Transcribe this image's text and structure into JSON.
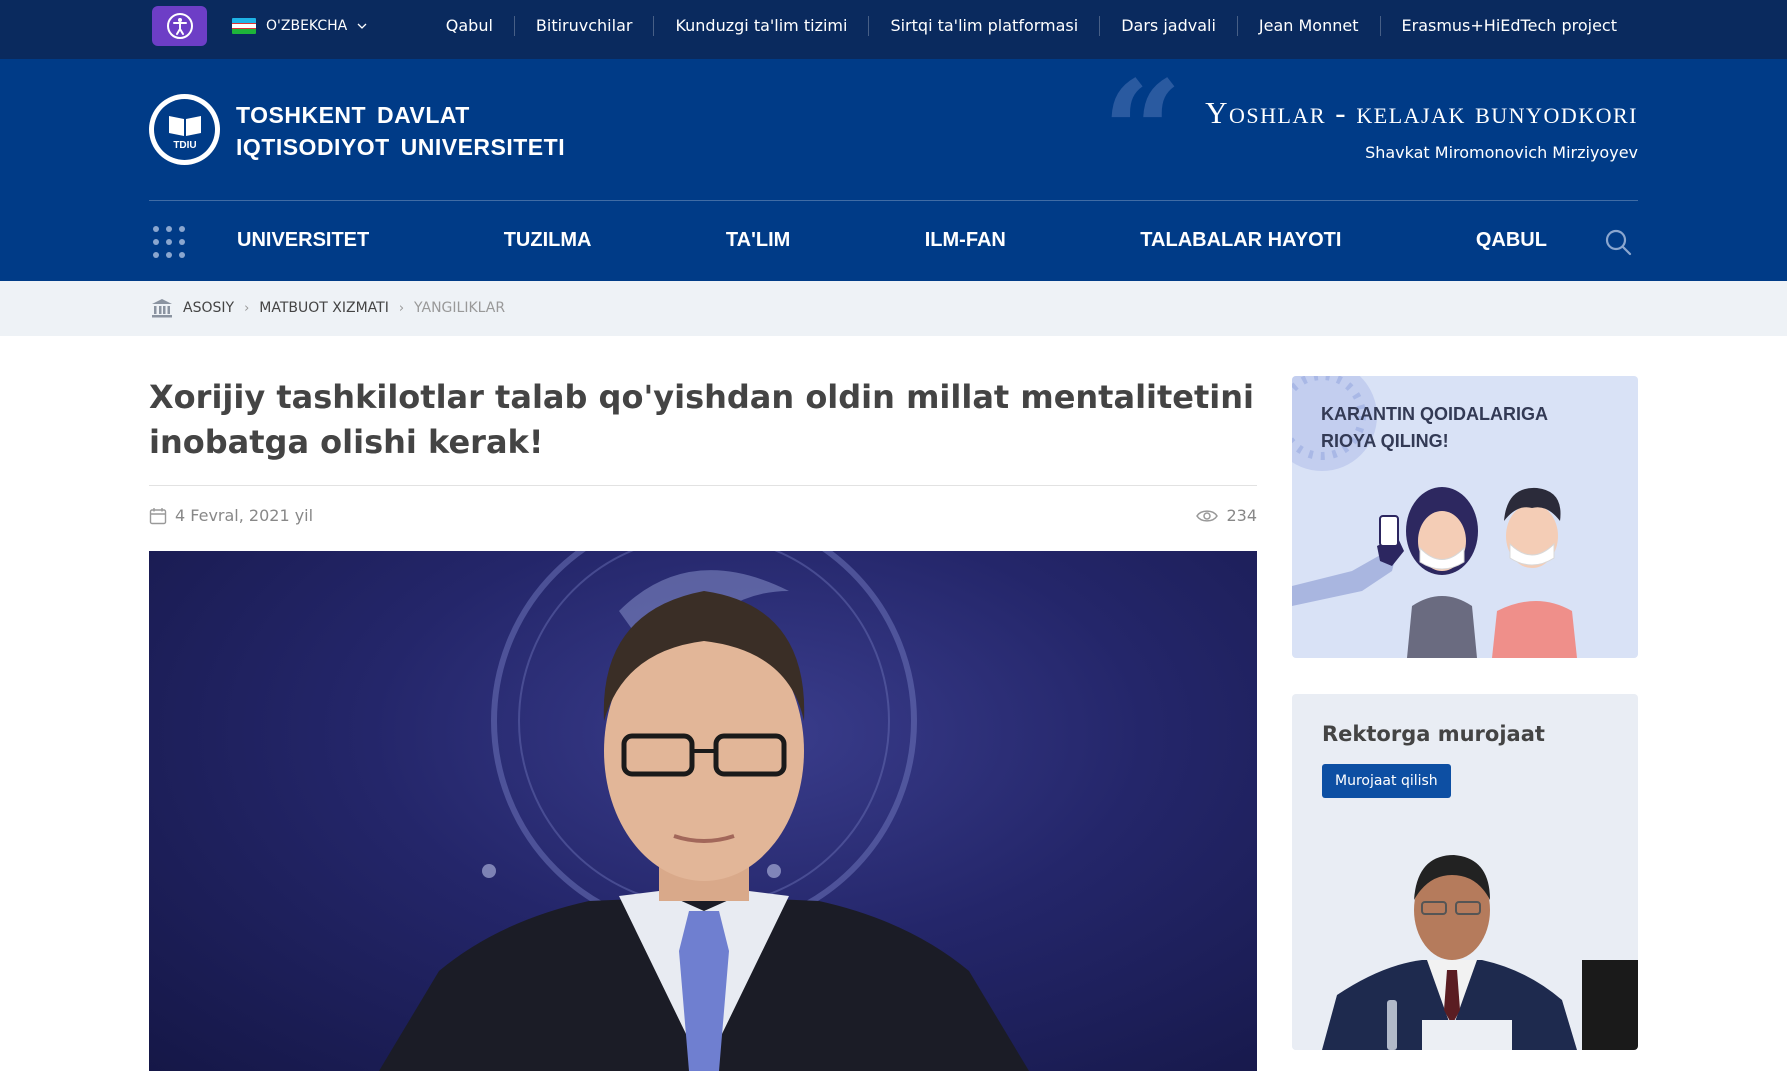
{
  "topbar": {
    "language": "O'ZBEKCHA",
    "links": [
      "Qabul",
      "Bitiruvchilar",
      "Kunduzgi ta'lim tizimi",
      "Sirtqi ta'lim platformasi",
      "Dars jadvali",
      "Jean Monnet",
      "Erasmus+HiEdTech project"
    ]
  },
  "header": {
    "logo_text": "TDIU",
    "uni_name_line1": "TOSHKENT  DAVLAT",
    "uni_name_line2": "IQTISODIYOT  UNIVERSITETI",
    "quote": "Yoshlar - kelajak bunyodkori",
    "quote_author": "Shavkat Miromonovich Mirziyoyev"
  },
  "nav": {
    "items": [
      "UNIVERSITET",
      "TUZILMA",
      "TA'LIM",
      "ILM-FAN",
      "TALABALAR HAYOTI",
      "QABUL"
    ]
  },
  "breadcrumb": {
    "home": "ASOSIY",
    "section": "MATBUOT XIZMATI",
    "current": "YANGILIKLAR"
  },
  "article": {
    "title": "Xorijiy tashkilotlar talab qo'yishdan oldin millat mentalitetini inobatga olishi kerak!",
    "date": "4 Fevral, 2021 yil",
    "views": "234"
  },
  "sidebar": {
    "quarantine_line1": "KARANTIN QOIDALARIGA",
    "quarantine_line2": "RIOYA QILING!",
    "rector_title": "Rektorga murojaat",
    "rector_button": "Murojaat qilish"
  },
  "colors": {
    "topbar": "#0a2a5e",
    "header": "#003b87",
    "accessibility": "#6d3ec6",
    "button": "#0d4fa3"
  }
}
